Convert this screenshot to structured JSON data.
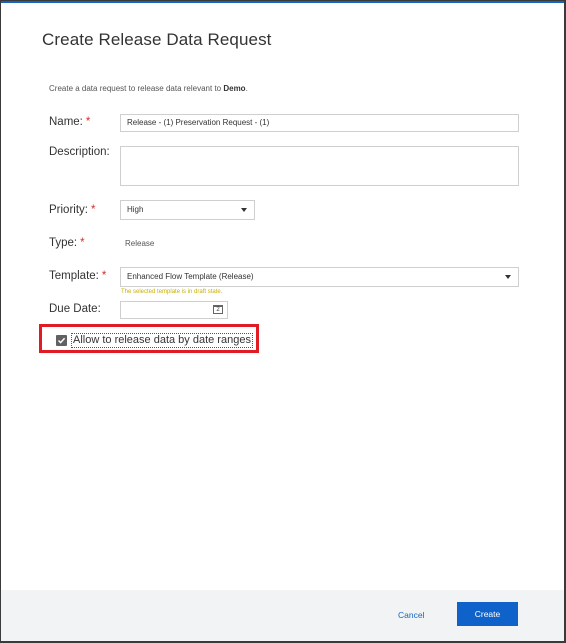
{
  "dialog": {
    "title": "Create Release Data Request",
    "intro_text": "Create a data request to release data relevant to ",
    "intro_matter": "Demo",
    "intro_suffix": "."
  },
  "form": {
    "name_label": "Name:",
    "name_value": "Release - (1) Preservation Request - (1)",
    "description_label": "Description:",
    "description_value": "",
    "priority_label": "Priority:",
    "priority_value": "High",
    "type_label": "Type:",
    "type_value": "Release",
    "template_label": "Template:",
    "template_value": "Enhanced Flow Template (Release)",
    "template_warning": "The selected template is in draft state.",
    "due_date_label": "Due Date:",
    "due_date_value": "",
    "calendar_day": "2",
    "required_marker": "*",
    "date_range_checkbox_label": "Allow to release data by date ranges",
    "date_range_checked": true
  },
  "footer": {
    "cancel_label": "Cancel",
    "create_label": "Create"
  },
  "colors": {
    "accent": "#0f62c9",
    "required": "#d32f2f",
    "warning": "#c9b000",
    "highlight_box": "#e01b24"
  }
}
